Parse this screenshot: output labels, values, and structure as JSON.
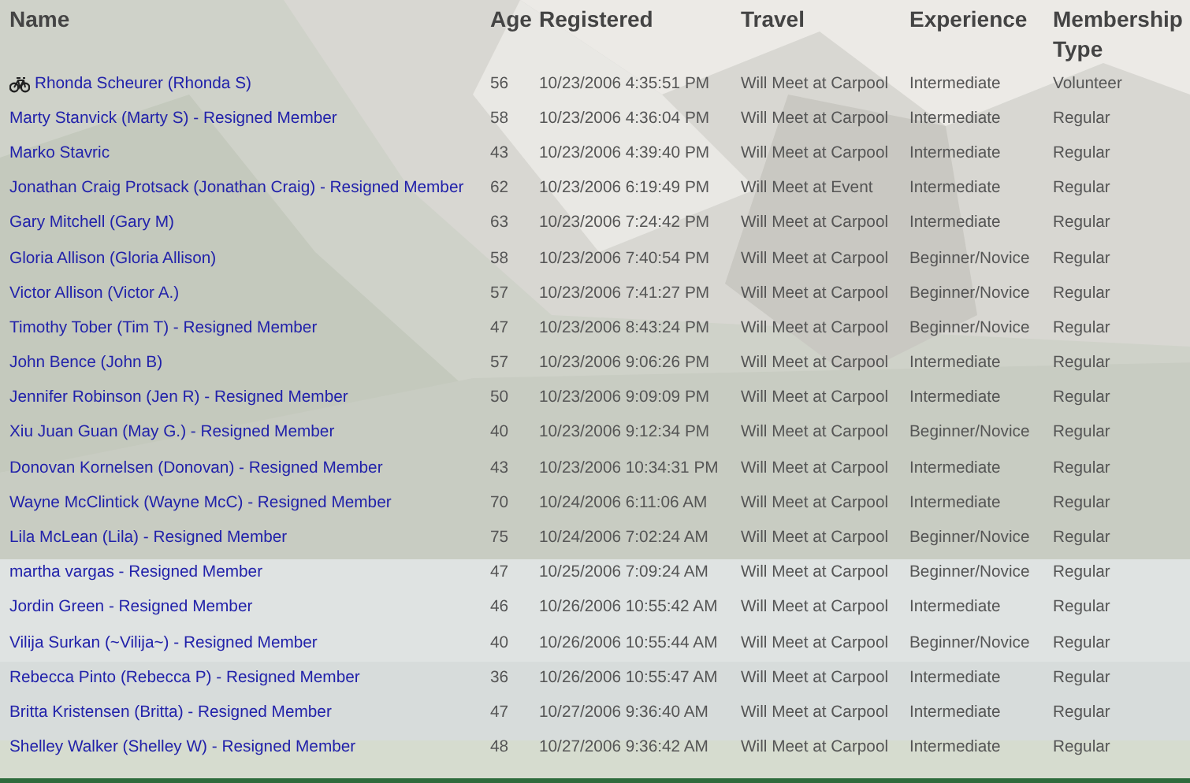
{
  "table": {
    "columns": [
      "Name",
      "Age",
      "Registered",
      "Travel",
      "Experience",
      "Membership Type"
    ],
    "rows": [
      {
        "name": "Rhonda Scheurer (Rhonda S)",
        "kind": "cyclist",
        "age": "56",
        "registered": "10/23/2006 4:35:51 PM",
        "travel": "Will Meet at Carpool",
        "experience": "Intermediate",
        "membership": "Volunteer"
      },
      {
        "name": "Marty Stanvick (Marty S) - Resigned Member",
        "age": "58",
        "registered": "10/23/2006 4:36:04 PM",
        "travel": "Will Meet at Carpool",
        "experience": "Intermediate",
        "membership": "Regular"
      },
      {
        "name": "Marko Stavric",
        "age": "43",
        "registered": "10/23/2006 4:39:40 PM",
        "travel": "Will Meet at Carpool",
        "experience": "Intermediate",
        "membership": "Regular"
      },
      {
        "name": "Jonathan Craig Protsack (Jonathan Craig) - Resigned Member",
        "age": "62",
        "registered": "10/23/2006 6:19:49 PM",
        "travel": "Will Meet at Event",
        "experience": "Intermediate",
        "membership": "Regular"
      },
      {
        "name": "Gary Mitchell (Gary M)",
        "age": "63",
        "registered": "10/23/2006 7:24:42 PM",
        "travel": "Will Meet at Carpool",
        "experience": "Intermediate",
        "membership": "Regular"
      },
      {
        "name": "Gloria Allison (Gloria Allison)",
        "age": "58",
        "registered": "10/23/2006 7:40:54 PM",
        "travel": "Will Meet at Carpool",
        "experience": "Beginner/Novice",
        "membership": "Regular"
      },
      {
        "name": "Victor Allison (Victor A.)",
        "age": "57",
        "registered": "10/23/2006 7:41:27 PM",
        "travel": "Will Meet at Carpool",
        "experience": "Beginner/Novice",
        "membership": "Regular"
      },
      {
        "name": "Timothy Tober (Tim T) - Resigned Member",
        "age": "47",
        "registered": "10/23/2006 8:43:24 PM",
        "travel": "Will Meet at Carpool",
        "experience": "Beginner/Novice",
        "membership": "Regular"
      },
      {
        "name": "John Bence (John B)",
        "age": "57",
        "registered": "10/23/2006 9:06:26 PM",
        "travel": "Will Meet at Carpool",
        "experience": "Intermediate",
        "membership": "Regular"
      },
      {
        "name": "Jennifer Robinson (Jen R) - Resigned Member",
        "age": "50",
        "registered": "10/23/2006 9:09:09 PM",
        "travel": "Will Meet at Carpool",
        "experience": "Intermediate",
        "membership": "Regular"
      },
      {
        "name": "Xiu Juan Guan (May G.) - Resigned Member",
        "age": "40",
        "registered": "10/23/2006 9:12:34 PM",
        "travel": "Will Meet at Carpool",
        "experience": "Beginner/Novice",
        "membership": "Regular"
      },
      {
        "name": "Donovan Kornelsen (Donovan) - Resigned Member",
        "age": "43",
        "registered": "10/23/2006 10:34:31 PM",
        "travel": "Will Meet at Carpool",
        "experience": "Intermediate",
        "membership": "Regular"
      },
      {
        "name": "Wayne McClintick (Wayne McC) - Resigned Member",
        "age": "70",
        "registered": "10/24/2006 6:11:06 AM",
        "travel": "Will Meet at Carpool",
        "experience": "Intermediate",
        "membership": "Regular"
      },
      {
        "name": "Lila McLean (Lila) - Resigned Member",
        "age": "75",
        "registered": "10/24/2006 7:02:24 AM",
        "travel": "Will Meet at Carpool",
        "experience": "Beginner/Novice",
        "membership": "Regular"
      },
      {
        "name": "martha vargas - Resigned Member",
        "age": "47",
        "registered": "10/25/2006 7:09:24 AM",
        "travel": "Will Meet at Carpool",
        "experience": "Beginner/Novice",
        "membership": "Regular"
      },
      {
        "name": "Jordin Green - Resigned Member",
        "age": "46",
        "registered": "10/26/2006 10:55:42 AM",
        "travel": "Will Meet at Carpool",
        "experience": "Intermediate",
        "membership": "Regular"
      },
      {
        "name": "Vilija Surkan (~Vilija~) - Resigned Member",
        "age": "40",
        "registered": "10/26/2006 10:55:44 AM",
        "travel": "Will Meet at Carpool",
        "experience": "Beginner/Novice",
        "membership": "Regular"
      },
      {
        "name": "Rebecca Pinto (Rebecca P) - Resigned Member",
        "age": "36",
        "registered": "10/26/2006 10:55:47 AM",
        "travel": "Will Meet at Carpool",
        "experience": "Intermediate",
        "membership": "Regular"
      },
      {
        "name": "Britta Kristensen (Britta) - Resigned Member",
        "age": "47",
        "registered": "10/27/2006 9:36:40 AM",
        "travel": "Will Meet at Carpool",
        "experience": "Intermediate",
        "membership": "Regular"
      },
      {
        "name": "Shelley Walker (Shelley W) - Resigned Member",
        "age": "48",
        "registered": "10/27/2006 9:36:42 AM",
        "travel": "Will Meet at Carpool",
        "experience": "Intermediate",
        "membership": "Regular"
      }
    ]
  }
}
